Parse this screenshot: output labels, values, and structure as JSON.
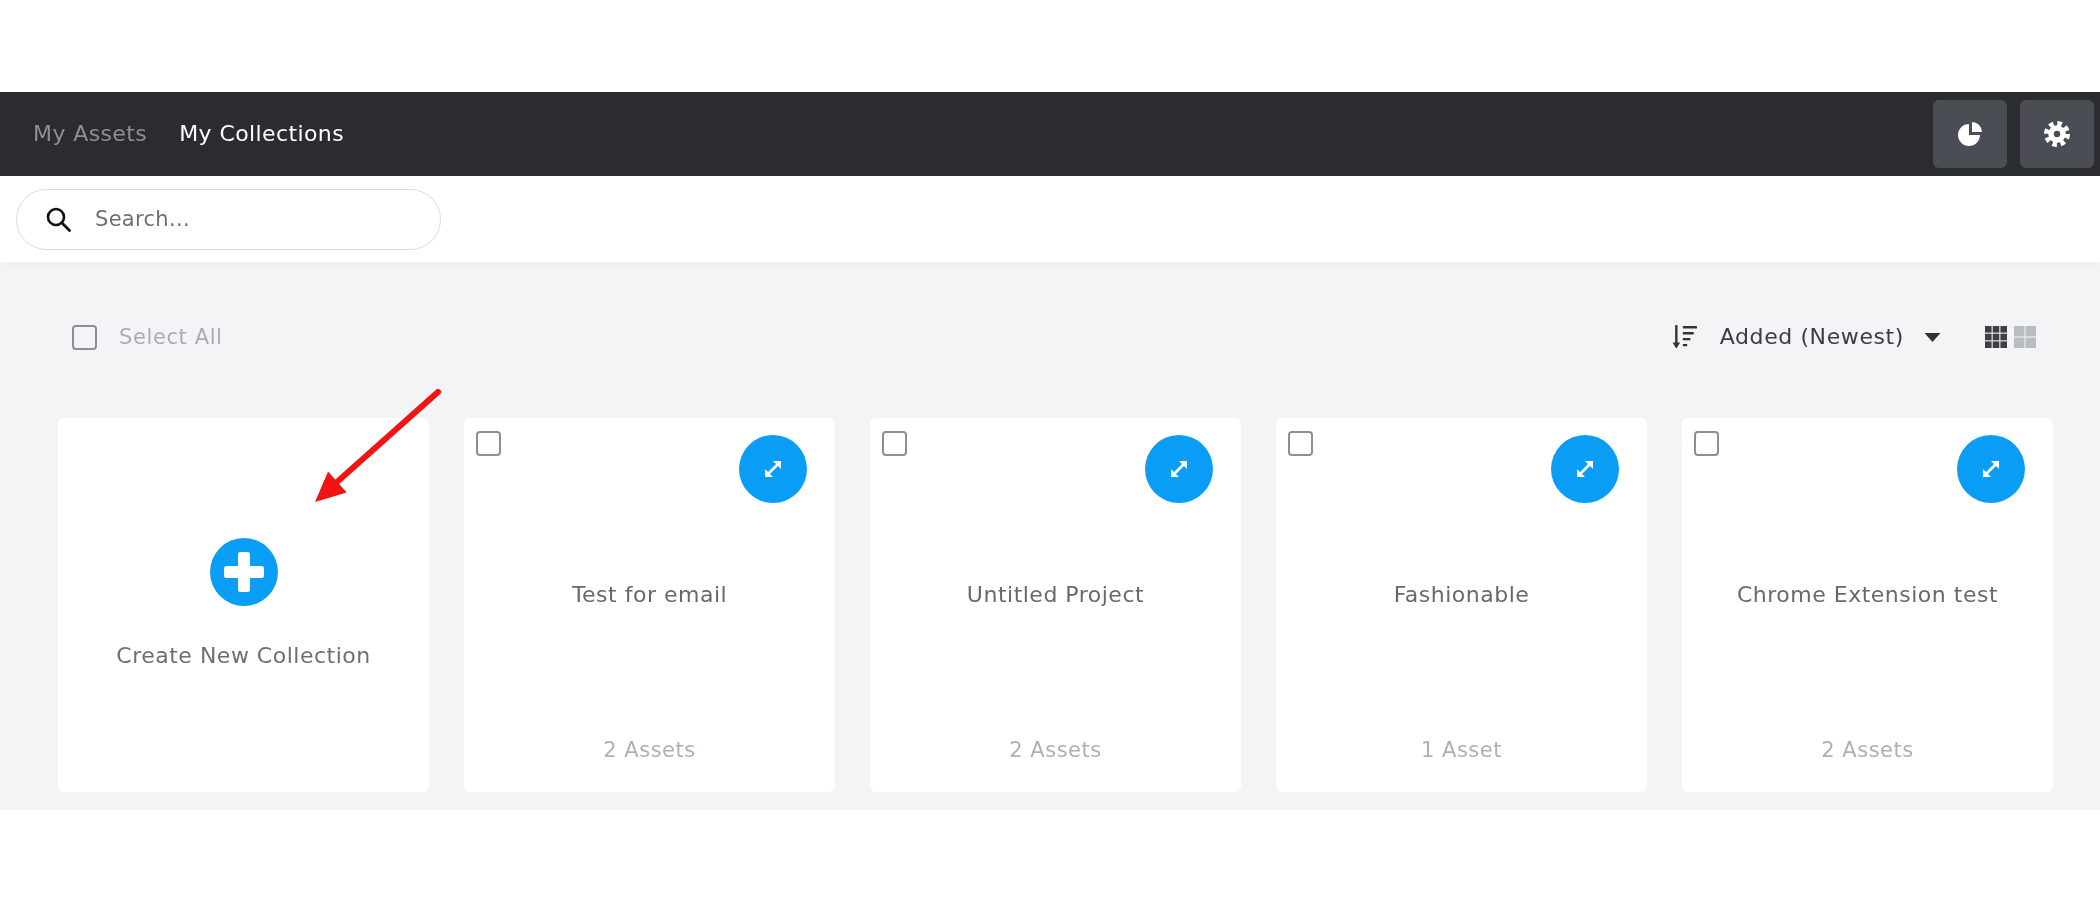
{
  "nav": {
    "tabs": [
      {
        "label": "My Assets",
        "selected": false
      },
      {
        "label": "My Collections",
        "selected": true
      }
    ],
    "buttons": [
      {
        "kind": "chart"
      },
      {
        "kind": "settings"
      }
    ]
  },
  "search": {
    "placeholder": "Search..."
  },
  "toolbar": {
    "select_all": {
      "label": "Select All",
      "checked": false
    },
    "sort": {
      "label": "Added (Newest)"
    },
    "view_modes": [
      {
        "kind": "small-grid",
        "selected": true
      },
      {
        "kind": "large-grid",
        "selected": false
      }
    ]
  },
  "create_card": {
    "label": "Create New Collection"
  },
  "collections": [
    {
      "title": "Test for email",
      "count": "2 Assets",
      "checked": false
    },
    {
      "title": "Untitled Project",
      "count": "2 Assets",
      "checked": false
    },
    {
      "title": "Fashionable",
      "count": "1 Asset",
      "checked": false
    },
    {
      "title": "Chrome Extension test",
      "count": "2 Assets",
      "checked": false
    }
  ]
}
